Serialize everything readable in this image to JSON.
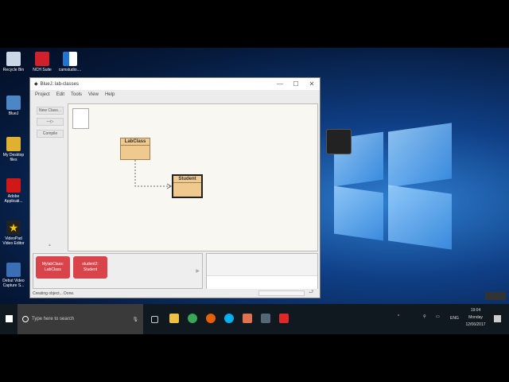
{
  "desktop": {
    "icons": [
      {
        "label": "Recycle Bin",
        "color": "#c9d7e6"
      },
      {
        "label": "NCH Suite",
        "color": "#d0202a"
      },
      {
        "label": "camstudio....",
        "color": "#1f77d0"
      },
      {
        "label": "BlueJ",
        "color": "#4b86c5"
      },
      {
        "label": "My Desktop files",
        "color": "#e0b030"
      },
      {
        "label": "Adobe Applicati...",
        "color": "#d01818"
      },
      {
        "label": "VideoPad Video Editor",
        "color": "#f2c200"
      },
      {
        "label": "Debut Video Capture S...",
        "color": "#3b6fb5"
      }
    ]
  },
  "window": {
    "title": "BlueJ: lab-classes",
    "controls": [
      "—",
      "☐",
      "✕"
    ],
    "menu": [
      "Project",
      "Edit",
      "Tools",
      "View",
      "Help"
    ],
    "buttons": {
      "new_class": "New Class...",
      "arrow": "—▷",
      "compile": "Compile"
    },
    "classes": [
      {
        "name": "LabClass"
      },
      {
        "name": "Student"
      }
    ],
    "objects": [
      {
        "line1": "MylabClass:",
        "line2": "LabClass"
      },
      {
        "line1": "student2:",
        "line2": "Student"
      }
    ],
    "status": "Creating object... Done."
  },
  "taskbar": {
    "search_placeholder": "Type here to search",
    "time": "19:04",
    "day": "Monday",
    "date": "12/06/2017",
    "lang": "ENG"
  }
}
